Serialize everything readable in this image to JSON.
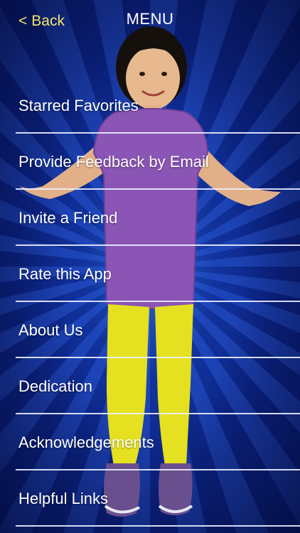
{
  "header": {
    "back_chevron": "<",
    "back_label": "Back",
    "title": "MENU"
  },
  "menu": {
    "items": [
      {
        "label": "Starred Favorites"
      },
      {
        "label": "Provide Feedback by Email"
      },
      {
        "label": "Invite a Friend"
      },
      {
        "label": "Rate this App"
      },
      {
        "label": "About Us"
      },
      {
        "label": "Dedication"
      },
      {
        "label": "Acknowledgements"
      },
      {
        "label": "Helpful Links"
      }
    ]
  },
  "colors": {
    "back_text": "#f3e36a",
    "title_text": "#ffffff",
    "background": "#0b2385",
    "divider": "#ebf0ff"
  }
}
